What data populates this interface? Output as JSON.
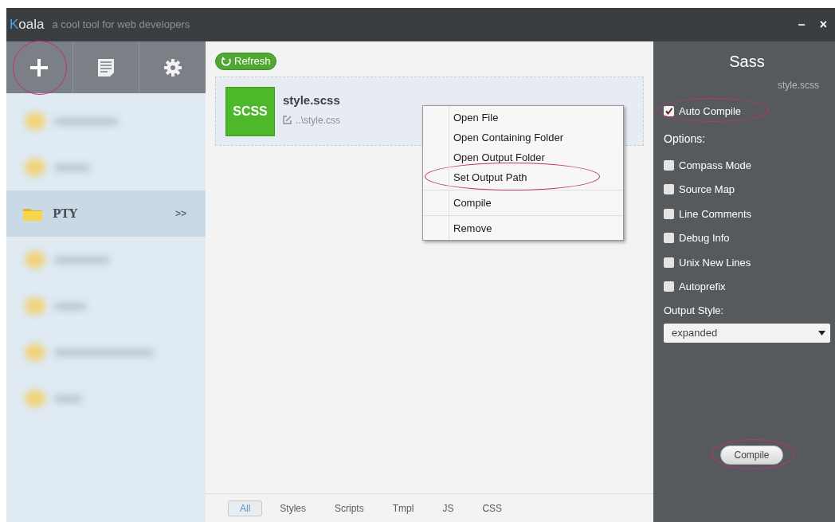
{
  "window": {
    "logo": "Koala",
    "tagline": "a cool tool for web developers",
    "controls": [
      "–",
      "×"
    ]
  },
  "toolbar": [
    {
      "kind": "add",
      "highlighted": true
    },
    {
      "kind": "log",
      "highlighted": false
    },
    {
      "kind": "settings",
      "highlighted": false
    }
  ],
  "projects": [
    {
      "kind": "blurred",
      "selected": false
    },
    {
      "kind": "blurred",
      "selected": false
    },
    {
      "kind": "named",
      "name": "PTY",
      "arrow": ">>",
      "selected": true
    },
    {
      "kind": "blurred",
      "selected": false
    },
    {
      "kind": "blurred",
      "selected": false
    },
    {
      "kind": "blurred",
      "selected": false
    },
    {
      "kind": "blurred",
      "selected": false
    }
  ],
  "refresh_button": "Refresh",
  "files": [
    {
      "badge": "SCSS",
      "name": "style.scss",
      "output": "..\\style.css"
    }
  ],
  "context_menu": [
    {
      "label": "Open File",
      "highlighted": false,
      "divider_after": false
    },
    {
      "label": "Open Containing Folder",
      "highlighted": false,
      "divider_after": false
    },
    {
      "label": "Open Output Folder",
      "highlighted": false,
      "divider_after": false
    },
    {
      "label": "Set Output Path",
      "highlighted": true,
      "divider_after": true
    },
    {
      "label": "Compile",
      "highlighted": false,
      "divider_after": true
    },
    {
      "label": "Remove",
      "highlighted": false,
      "divider_after": false
    }
  ],
  "filter_tabs": [
    {
      "label": "All",
      "selected": true
    },
    {
      "label": "Styles",
      "selected": false
    },
    {
      "label": "Scripts",
      "selected": false
    },
    {
      "label": "Tmpl",
      "selected": false
    },
    {
      "label": "JS",
      "selected": false
    },
    {
      "label": "CSS",
      "selected": false
    }
  ],
  "panel": {
    "title": "Sass",
    "file": "style.scss",
    "auto_compile": {
      "label": "Auto Compile",
      "checked": true,
      "highlighted": true
    },
    "options_heading": "Options:",
    "options": [
      {
        "label": "Compass Mode",
        "checked": false
      },
      {
        "label": "Source Map",
        "checked": false
      },
      {
        "label": "Line Comments",
        "checked": false
      },
      {
        "label": "Debug Info",
        "checked": false
      },
      {
        "label": "Unix New Lines",
        "checked": false
      },
      {
        "label": "Autoprefix",
        "checked": false
      }
    ],
    "output_style_label": "Output Style:",
    "output_style": "expanded",
    "compile_button": {
      "label": "Compile",
      "highlighted": true
    }
  }
}
